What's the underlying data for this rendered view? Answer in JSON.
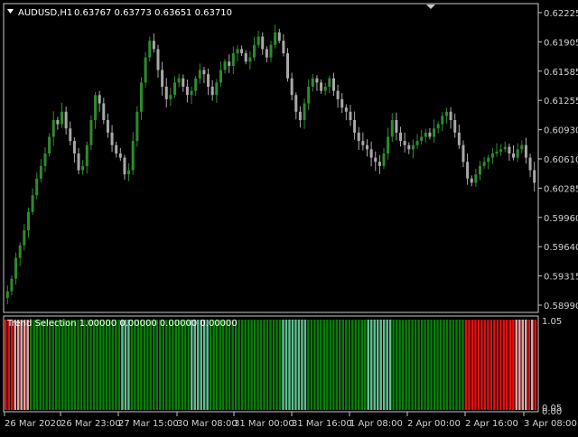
{
  "header": {
    "symbol": "AUDUSD,H1",
    "ohlc": "0.63767 0.63773 0.63651 0.63710"
  },
  "indicator": {
    "label": "Trend Selection 1.00000 0.00000 0.00000 0.00000",
    "scale_top": "1.05",
    "scale_bottom": "0.05",
    "scale_bottom2": "0.00",
    "colors": {
      "green": "#0a7d0a",
      "lightgreen": "#5fbf8f",
      "red": "#e01010",
      "pink": "#f0a0a0"
    },
    "segments": [
      {
        "color": "red",
        "count": 3
      },
      {
        "color": "pink",
        "count": 5
      },
      {
        "color": "green",
        "count": 29
      },
      {
        "color": "lightgreen",
        "count": 3
      },
      {
        "color": "green",
        "count": 19
      },
      {
        "color": "lightgreen",
        "count": 6
      },
      {
        "color": "green",
        "count": 23
      },
      {
        "color": "lightgreen",
        "count": 8
      },
      {
        "color": "green",
        "count": 19
      },
      {
        "color": "lightgreen",
        "count": 8
      },
      {
        "color": "green",
        "count": 23
      },
      {
        "color": "red",
        "count": 16
      },
      {
        "color": "pink",
        "count": 4
      },
      {
        "color": "red",
        "count": 1
      },
      {
        "color": "pink",
        "count": 1
      },
      {
        "color": "red",
        "count": 1
      }
    ]
  },
  "price_axis": [
    "0.62225",
    "0.61905",
    "0.61585",
    "0.61255",
    "0.60930",
    "0.60610",
    "0.60285",
    "0.59960",
    "0.59640",
    "0.59315",
    "0.58990"
  ],
  "time_axis": [
    "26 Mar 2020",
    "26 Mar 23:00",
    "27 Mar 15:00",
    "30 Mar 08:00",
    "31 Mar 00:00",
    "31 Mar 16:00",
    "1 Apr 08:00",
    "2 Apr 00:00",
    "2 Apr 16:00",
    "3 Apr 08:00"
  ],
  "chart_data": {
    "type": "candlestick",
    "y_range": [
      0.5887,
      0.6233
    ],
    "colors": {
      "up": "#2e8b2e",
      "down": "#a8a8a8"
    },
    "closes": [
      0.5895,
      0.591,
      0.5935,
      0.595,
      0.5968,
      0.599,
      0.601,
      0.603,
      0.6045,
      0.606,
      0.608,
      0.61,
      0.6095,
      0.611,
      0.609,
      0.6075,
      0.606,
      0.604,
      0.6045,
      0.607,
      0.61,
      0.613,
      0.612,
      0.61,
      0.6085,
      0.607,
      0.606,
      0.6055,
      0.6035,
      0.604,
      0.6075,
      0.611,
      0.6145,
      0.6175,
      0.6195,
      0.6185,
      0.616,
      0.614,
      0.6125,
      0.613,
      0.6145,
      0.615,
      0.614,
      0.613,
      0.6135,
      0.615,
      0.616,
      0.6155,
      0.614,
      0.613,
      0.6145,
      0.616,
      0.617,
      0.6165,
      0.618,
      0.6185,
      0.618,
      0.617,
      0.6175,
      0.619,
      0.62,
      0.6185,
      0.6175,
      0.619,
      0.6205,
      0.6195,
      0.618,
      0.615,
      0.613,
      0.611,
      0.61,
      0.612,
      0.614,
      0.615,
      0.6145,
      0.6135,
      0.614,
      0.615,
      0.6135,
      0.6125,
      0.6115,
      0.611,
      0.61,
      0.6085,
      0.6075,
      0.607,
      0.6065,
      0.6055,
      0.605,
      0.6045,
      0.606,
      0.608,
      0.61,
      0.6085,
      0.6075,
      0.607,
      0.6065,
      0.607,
      0.6075,
      0.608,
      0.6085,
      0.608,
      0.609,
      0.6095,
      0.6105,
      0.611,
      0.61,
      0.6085,
      0.607,
      0.605,
      0.603,
      0.6025,
      0.6035,
      0.6045,
      0.605,
      0.6055,
      0.606,
      0.6062,
      0.6065,
      0.6068,
      0.606,
      0.6055,
      0.6065,
      0.607,
      0.6055,
      0.604,
      0.6025
    ]
  }
}
